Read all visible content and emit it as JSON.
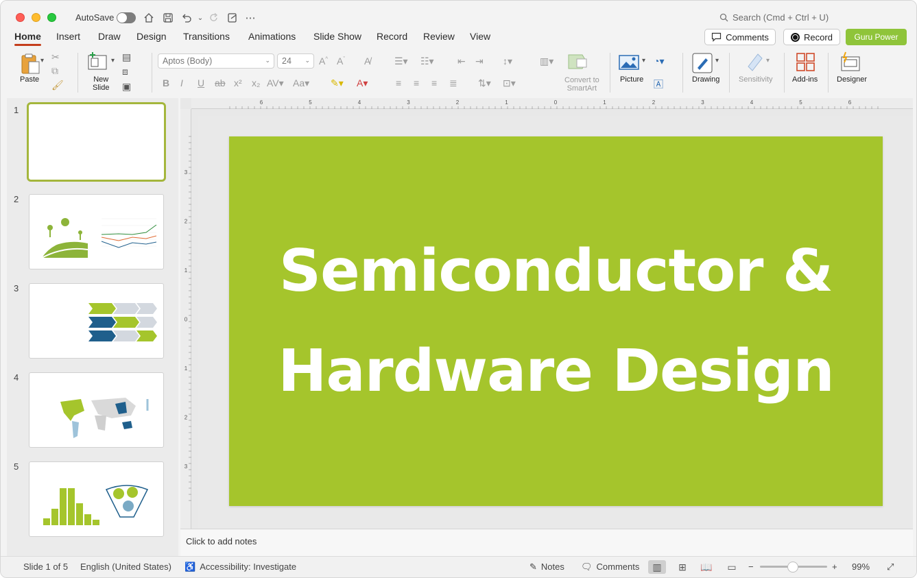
{
  "titlebar": {
    "autosave_label": "AutoSave",
    "search_placeholder": "Search (Cmd + Ctrl + U)",
    "icons": [
      "home-icon",
      "save-icon",
      "undo-icon",
      "redo-icon",
      "customize-icon",
      "more-icon"
    ]
  },
  "tabs": [
    {
      "label": "Home",
      "active": true
    },
    {
      "label": "Insert"
    },
    {
      "label": "Draw"
    },
    {
      "label": "Design"
    },
    {
      "label": "Transitions"
    },
    {
      "label": "Animations"
    },
    {
      "label": "Slide Show"
    },
    {
      "label": "Record"
    },
    {
      "label": "Review"
    },
    {
      "label": "View"
    }
  ],
  "header_buttons": {
    "comments": "Comments",
    "record": "Record",
    "guru": "Guru Power"
  },
  "ribbon": {
    "paste": "Paste",
    "new_slide": "New\nSlide",
    "font_name": "Aptos (Body)",
    "font_size": "24",
    "convert_smartart_line1": "Convert to",
    "convert_smartart_line2": "SmartArt",
    "picture": "Picture",
    "drawing": "Drawing",
    "sensitivity": "Sensitivity",
    "addins": "Add-ins",
    "designer": "Designer"
  },
  "thumbnails": [
    {
      "number": "1",
      "selected": true
    },
    {
      "number": "2"
    },
    {
      "number": "3"
    },
    {
      "number": "4"
    },
    {
      "number": "5"
    }
  ],
  "slide": {
    "title_line1": "Semiconductor &",
    "title_line2": "Hardware Design",
    "background_color": "#a5c52c"
  },
  "notes": {
    "placeholder": "Click to add notes"
  },
  "status": {
    "slide_position": "Slide 1 of 5",
    "language": "English (United States)",
    "accessibility": "Accessibility: Investigate",
    "notes": "Notes",
    "comments": "Comments",
    "zoom": "99%"
  },
  "ruler": {
    "horizontal_labels": [
      "6",
      "5",
      "4",
      "3",
      "2",
      "1",
      "0",
      "1",
      "2",
      "3",
      "4",
      "5",
      "6"
    ],
    "vertical_labels": [
      "3",
      "2",
      "1",
      "0",
      "1",
      "2",
      "3"
    ]
  }
}
